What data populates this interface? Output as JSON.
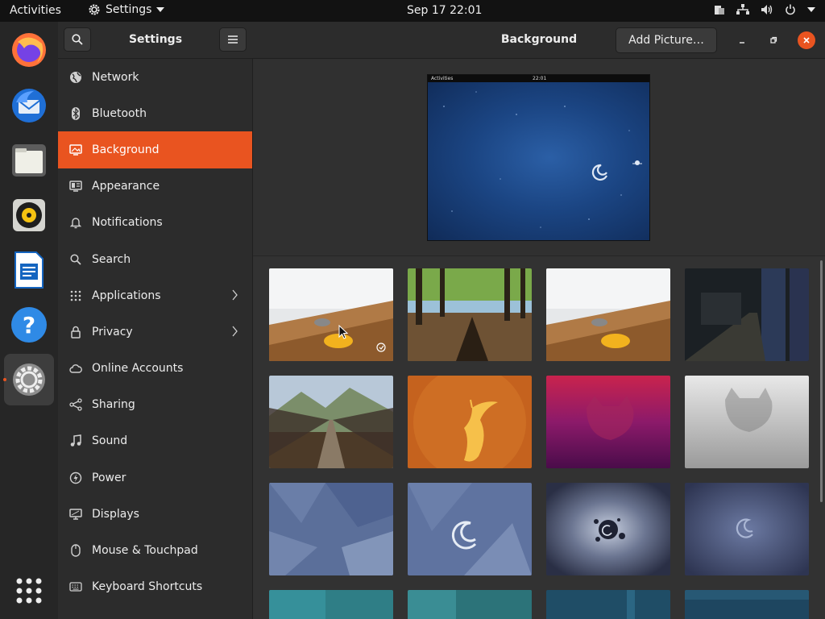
{
  "topbar": {
    "activities": "Activities",
    "app_menu": "Settings",
    "clock": "Sep 17  22:01"
  },
  "dock": {
    "items": [
      "firefox-icon",
      "thunderbird-icon",
      "files-icon",
      "rhythmbox-icon",
      "libreoffice-writer-icon",
      "help-icon",
      "settings-icon",
      "show-apps-icon"
    ],
    "active": "settings-icon"
  },
  "sidebar": {
    "title": "Settings",
    "items": [
      {
        "label": "Network",
        "icon": "network-icon"
      },
      {
        "label": "Bluetooth",
        "icon": "bluetooth-icon"
      },
      {
        "label": "Background",
        "icon": "background-icon",
        "selected": true
      },
      {
        "label": "Appearance",
        "icon": "appearance-icon"
      },
      {
        "label": "Notifications",
        "icon": "bell-icon"
      },
      {
        "label": "Search",
        "icon": "search-icon"
      },
      {
        "label": "Applications",
        "icon": "apps-grid-icon",
        "chevron": true
      },
      {
        "label": "Privacy",
        "icon": "lock-icon",
        "chevron": true
      },
      {
        "label": "Online Accounts",
        "icon": "cloud-icon"
      },
      {
        "label": "Sharing",
        "icon": "share-icon"
      },
      {
        "label": "Sound",
        "icon": "music-note-icon"
      },
      {
        "label": "Power",
        "icon": "power-icon"
      },
      {
        "label": "Displays",
        "icon": "display-icon"
      },
      {
        "label": "Mouse & Touchpad",
        "icon": "mouse-icon"
      },
      {
        "label": "Keyboard Shortcuts",
        "icon": "keyboard-icon"
      }
    ]
  },
  "main": {
    "title": "Background",
    "add_picture": "Add Picture…",
    "preview": {
      "activities": "Activities",
      "clock": "22:01"
    }
  },
  "wallpapers": [
    {
      "name": "desk-marker",
      "selected": true
    },
    {
      "name": "forest-shadow"
    },
    {
      "name": "desk-marker-2"
    },
    {
      "name": "dark-corridor"
    },
    {
      "name": "suspension-bridge"
    },
    {
      "name": "orange-bird"
    },
    {
      "name": "purple-cat"
    },
    {
      "name": "grey-cat"
    },
    {
      "name": "blue-polygons"
    },
    {
      "name": "debian-swirl-blue"
    },
    {
      "name": "debian-splash"
    },
    {
      "name": "debian-swirl-dark"
    },
    {
      "name": "teal-1"
    },
    {
      "name": "teal-2"
    },
    {
      "name": "teal-3"
    },
    {
      "name": "teal-4"
    }
  ],
  "colors": {
    "accent": "#e95420",
    "panel": "#2c2c2c",
    "content": "#323232"
  }
}
